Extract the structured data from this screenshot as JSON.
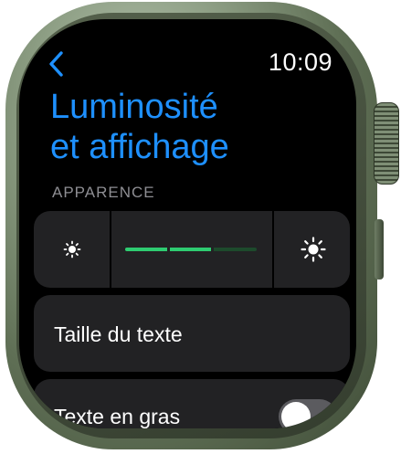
{
  "status_bar": {
    "time": "10:09"
  },
  "header": {
    "title_line1": "Luminosité",
    "title_line2": "et affichage",
    "back_icon": "chevron-left-icon"
  },
  "appearance": {
    "section_label": "APPARENCE",
    "brightness": {
      "decrease_icon": "sun-small-icon",
      "increase_icon": "sun-large-icon",
      "level": 0.67,
      "segments": 3
    }
  },
  "settings": {
    "text_size_label": "Taille du texte",
    "bold_text_label": "Texte en gras",
    "bold_text_enabled": false
  },
  "colors": {
    "accent": "#1e90ff",
    "level_fill": "#2ecc71",
    "level_track": "#1d4a2c",
    "row_background": "#222224",
    "section_header": "#8e8e93"
  }
}
